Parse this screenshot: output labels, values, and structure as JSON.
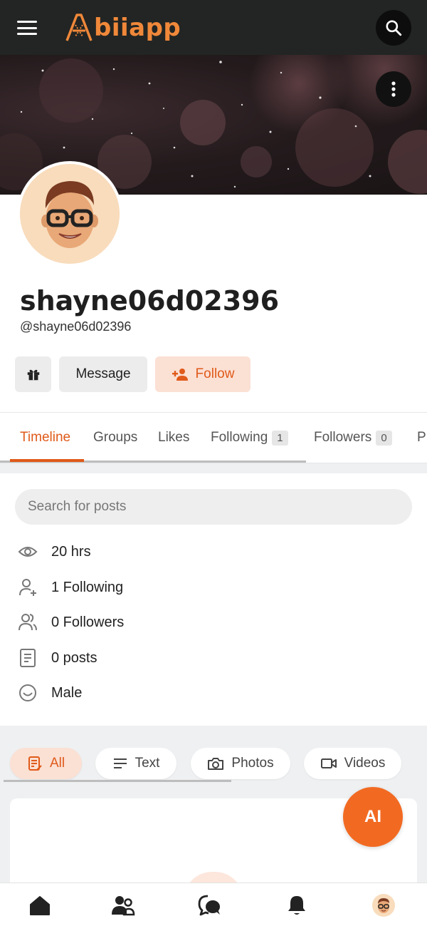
{
  "app": {
    "logo_text": "biiapp",
    "brand_color": "#f26a22"
  },
  "header": {
    "menu_icon": "hamburger-menu-icon",
    "search_icon": "search-icon"
  },
  "cover": {
    "options_icon": "more-vertical-icon"
  },
  "profile": {
    "username": "shayne06d02396",
    "handle": "@shayne06d02396"
  },
  "actions": {
    "gift_icon": "gift-icon",
    "message_label": "Message",
    "follow_label": "Follow"
  },
  "tabs": [
    {
      "label": "Timeline",
      "active": true
    },
    {
      "label": "Groups"
    },
    {
      "label": "Likes"
    },
    {
      "label": "Following",
      "count": "1"
    },
    {
      "label": "Followers",
      "count": "0"
    },
    {
      "label": "P"
    }
  ],
  "search": {
    "placeholder": "Search for posts"
  },
  "info": [
    {
      "icon": "eye-icon",
      "text": "20 hrs"
    },
    {
      "icon": "add-user-icon",
      "text": "1 Following"
    },
    {
      "icon": "users-icon",
      "text": "0 Followers"
    },
    {
      "icon": "document-icon",
      "text": "0 posts"
    },
    {
      "icon": "smile-icon",
      "text": "Male"
    }
  ],
  "filters": [
    {
      "label": "All",
      "icon": "list-doc-icon",
      "active": true
    },
    {
      "label": "Text",
      "icon": "text-lines-icon"
    },
    {
      "label": "Photos",
      "icon": "camera-icon"
    },
    {
      "label": "Videos",
      "icon": "video-icon"
    }
  ],
  "ai_button": {
    "label": "AI"
  },
  "bottom_nav": [
    {
      "icon": "home-icon"
    },
    {
      "icon": "people-icon"
    },
    {
      "icon": "chat-icon"
    },
    {
      "icon": "bell-icon"
    },
    {
      "icon": "profile-avatar-icon"
    }
  ]
}
